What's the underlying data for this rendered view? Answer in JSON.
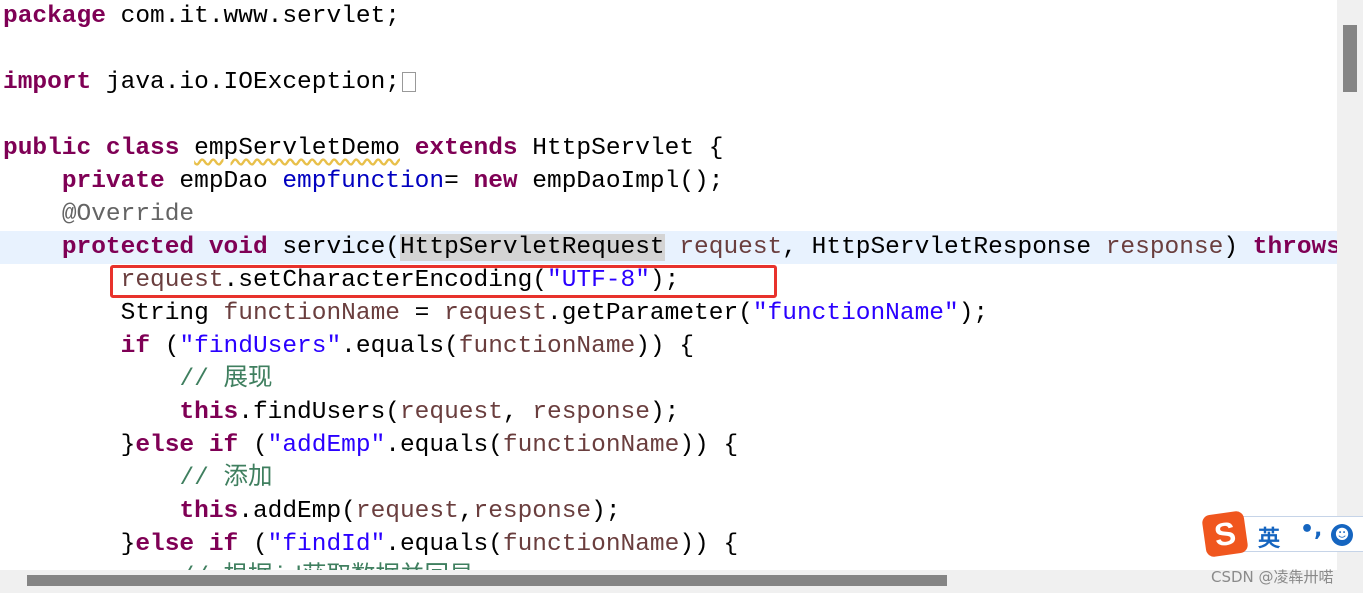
{
  "editor": {
    "current_line": 7,
    "lines": [
      [
        {
          "t": "package",
          "c": "kw"
        },
        {
          "t": " com.it.www.servlet;"
        }
      ],
      [],
      [
        {
          "t": "import",
          "c": "kw"
        },
        {
          "t": " java.io.IOException;"
        },
        {
          "fold": true
        }
      ],
      [],
      [
        {
          "t": "public",
          "c": "kw"
        },
        {
          "t": " "
        },
        {
          "t": "class",
          "c": "kw"
        },
        {
          "t": " "
        },
        {
          "t": "empServletDemo",
          "c": "warn"
        },
        {
          "t": " "
        },
        {
          "t": "extends",
          "c": "kw"
        },
        {
          "t": " HttpServlet {"
        }
      ],
      [
        {
          "t": "    "
        },
        {
          "t": "private",
          "c": "kw"
        },
        {
          "t": " empDao "
        },
        {
          "t": "empfunction",
          "c": "field"
        },
        {
          "t": "= "
        },
        {
          "t": "new",
          "c": "kw"
        },
        {
          "t": " empDaoImpl();"
        }
      ],
      [
        {
          "t": "    "
        },
        {
          "t": "@Override",
          "c": "ann"
        }
      ],
      [
        {
          "t": "    "
        },
        {
          "t": "protected",
          "c": "kw"
        },
        {
          "t": " "
        },
        {
          "t": "void",
          "c": "kw"
        },
        {
          "t": " service("
        },
        {
          "t": "HttpServletRequest",
          "c": "hl"
        },
        {
          "t": " "
        },
        {
          "t": "request",
          "c": "var"
        },
        {
          "t": ", HttpServletResponse "
        },
        {
          "t": "response",
          "c": "var"
        },
        {
          "t": ") "
        },
        {
          "t": "throws",
          "c": "kw"
        }
      ],
      [
        {
          "t": "        "
        },
        {
          "t": "request",
          "c": "var"
        },
        {
          "t": ".setCharacterEncoding("
        },
        {
          "t": "\"UTF-8\"",
          "c": "str"
        },
        {
          "t": ");"
        }
      ],
      [
        {
          "t": "        String "
        },
        {
          "t": "functionName",
          "c": "var"
        },
        {
          "t": " = "
        },
        {
          "t": "request",
          "c": "var"
        },
        {
          "t": ".getParameter("
        },
        {
          "t": "\"functionName\"",
          "c": "str"
        },
        {
          "t": ");"
        }
      ],
      [
        {
          "t": "        "
        },
        {
          "t": "if",
          "c": "kw"
        },
        {
          "t": " ("
        },
        {
          "t": "\"findUsers\"",
          "c": "str"
        },
        {
          "t": ".equals("
        },
        {
          "t": "functionName",
          "c": "var"
        },
        {
          "t": ")) {"
        }
      ],
      [
        {
          "t": "            "
        },
        {
          "t": "// 展现",
          "c": "com"
        }
      ],
      [
        {
          "t": "            "
        },
        {
          "t": "this",
          "c": "kw"
        },
        {
          "t": ".findUsers("
        },
        {
          "t": "request",
          "c": "var"
        },
        {
          "t": ", "
        },
        {
          "t": "response",
          "c": "var"
        },
        {
          "t": ");"
        }
      ],
      [
        {
          "t": "        }"
        },
        {
          "t": "else",
          "c": "kw"
        },
        {
          "t": " "
        },
        {
          "t": "if",
          "c": "kw"
        },
        {
          "t": " ("
        },
        {
          "t": "\"addEmp\"",
          "c": "str"
        },
        {
          "t": ".equals("
        },
        {
          "t": "functionName",
          "c": "var"
        },
        {
          "t": ")) {"
        }
      ],
      [
        {
          "t": "            "
        },
        {
          "t": "// 添加",
          "c": "com"
        }
      ],
      [
        {
          "t": "            "
        },
        {
          "t": "this",
          "c": "kw"
        },
        {
          "t": ".addEmp("
        },
        {
          "t": "request",
          "c": "var"
        },
        {
          "t": ","
        },
        {
          "t": "response",
          "c": "var"
        },
        {
          "t": ");"
        }
      ],
      [
        {
          "t": "        }"
        },
        {
          "t": "else",
          "c": "kw"
        },
        {
          "t": " "
        },
        {
          "t": "if",
          "c": "kw"
        },
        {
          "t": " ("
        },
        {
          "t": "\"findId\"",
          "c": "str"
        },
        {
          "t": ".equals("
        },
        {
          "t": "functionName",
          "c": "var"
        },
        {
          "t": ")) {"
        }
      ],
      [
        {
          "t": "            "
        },
        {
          "t": "// 根据id获取数据并回显",
          "c": "com"
        }
      ]
    ]
  },
  "ime": {
    "logo": "S",
    "language": "英",
    "punctuation": "•,",
    "emoji": "☻"
  },
  "watermark": "CSDN @凌犇卅喏",
  "colors": {
    "keyword": "#7f0055",
    "string": "#2a00ff",
    "variable": "#6a3e3e",
    "comment": "#3f7f5f",
    "annotation": "#646464",
    "field": "#0000c0",
    "highlight_box": "#e8322c",
    "current_line": "#e8f2fe"
  }
}
